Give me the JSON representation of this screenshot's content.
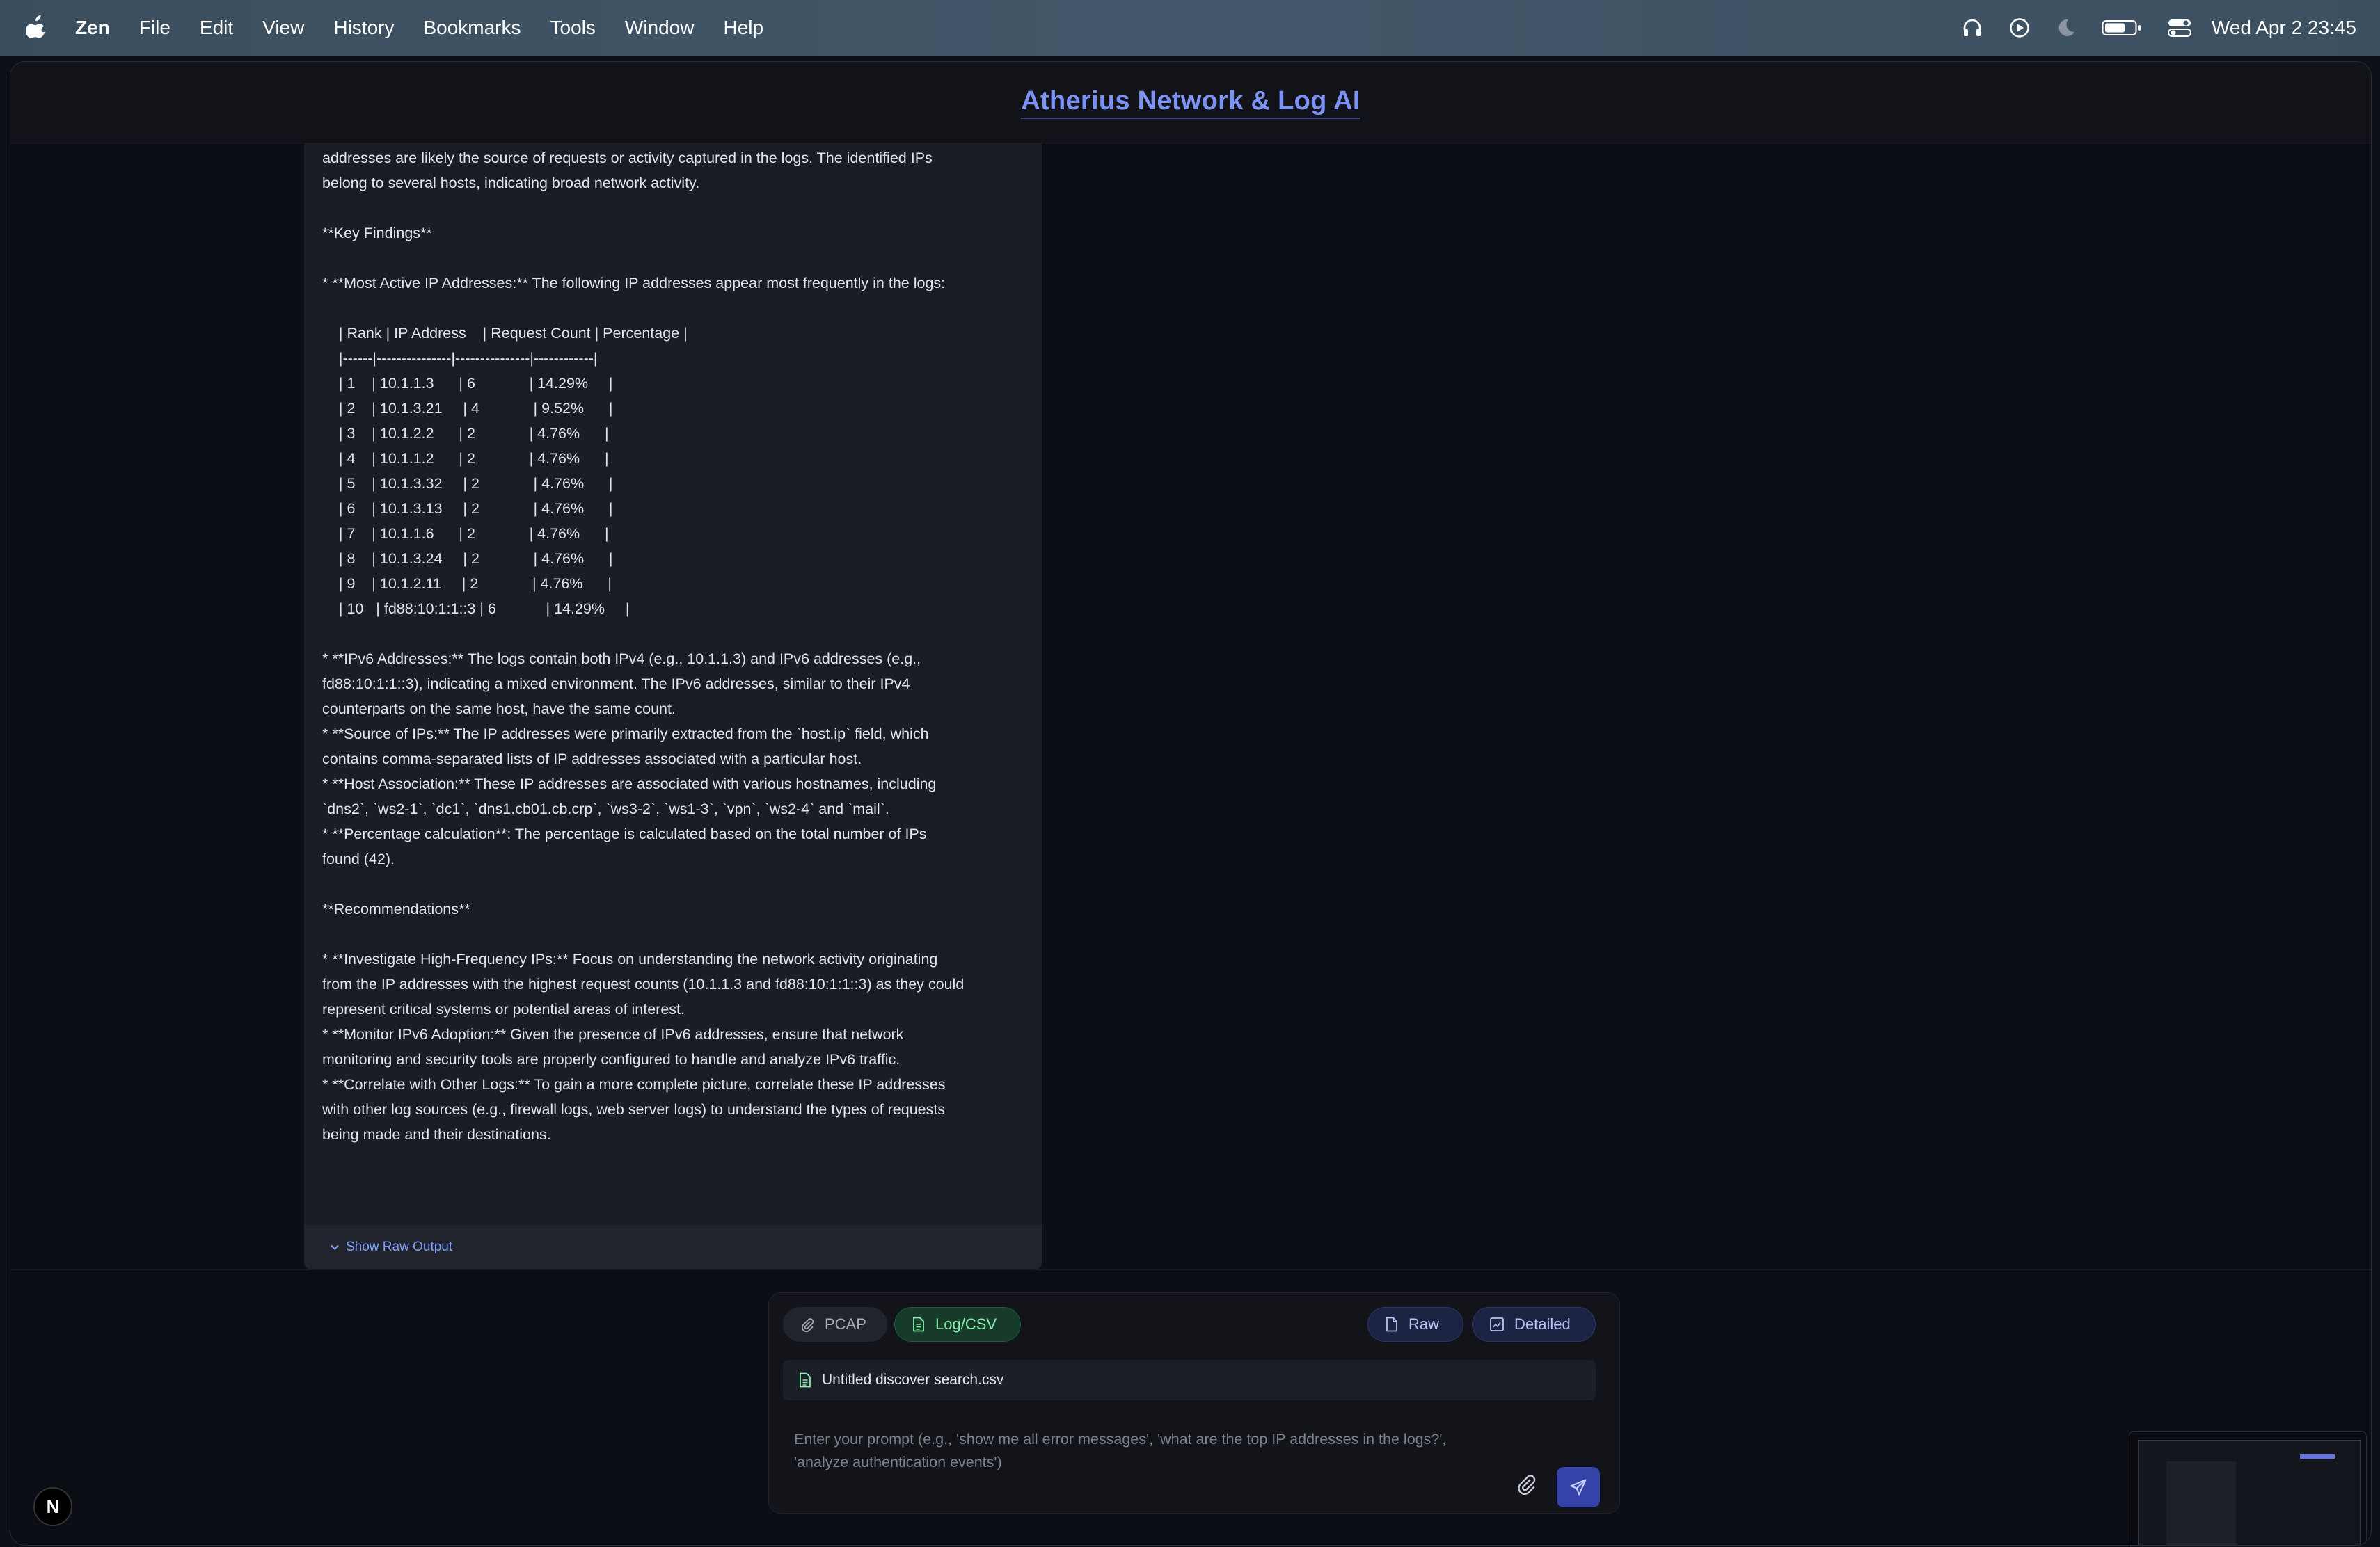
{
  "menubar": {
    "app_name": "Zen",
    "menus": [
      "File",
      "Edit",
      "View",
      "History",
      "Bookmarks",
      "Tools",
      "Window",
      "Help"
    ],
    "clock": "Wed Apr 2  23:45"
  },
  "app": {
    "title": "Atherius Network & Log AI"
  },
  "message": {
    "lines": [
      "addresses are likely the source of requests or activity captured in the logs. The identified IPs",
      "belong to several hosts, indicating broad network activity.",
      "",
      "**Key Findings**",
      "",
      "*   **Most Active IP Addresses:** The following IP addresses appear most frequently in the logs:",
      "",
      "    | Rank | IP Address    | Request Count | Percentage |",
      "    |------|---------------|---------------|------------|",
      "    | 1    | 10.1.1.3      | 6             | 14.29%     |",
      "    | 2    | 10.1.3.21     | 4             | 9.52%      |",
      "    | 3    | 10.1.2.2      | 2             | 4.76%      |",
      "    | 4    | 10.1.1.2      | 2             | 4.76%      |",
      "    | 5    | 10.1.3.32     | 2             | 4.76%      |",
      "    | 6    | 10.1.3.13     | 2             | 4.76%      |",
      "    | 7    | 10.1.1.6      | 2             | 4.76%      |",
      "    | 8    | 10.1.3.24     | 2             | 4.76%      |",
      "    | 9    | 10.1.2.11     | 2             | 4.76%      |",
      "    | 10   | fd88:10:1:1::3 | 6            | 14.29%     |",
      "",
      "*   **IPv6 Addresses:** The logs contain both IPv4 (e.g., 10.1.1.3) and IPv6 addresses (e.g.,",
      "fd88:10:1:1::3), indicating a mixed environment. The IPv6 addresses, similar to their IPv4",
      "counterparts on the same host, have the same count.",
      "*   **Source of IPs:** The IP addresses were primarily extracted from the `host.ip` field, which",
      "contains comma-separated lists of IP addresses associated with a particular host.",
      "*   **Host Association:** These IP addresses are associated with various hostnames, including",
      "`dns2`, `ws2-1`, `dc1`, `dns1.cb01.cb.crp`, `ws3-2`, `ws1-3`, `vpn`, `ws2-4` and `mail`.",
      "*   **Percentage calculation**: The percentage is calculated based on the total number of IPs",
      "found (42).",
      "",
      "**Recommendations**",
      "",
      "*   **Investigate High-Frequency IPs:** Focus on understanding the network activity originating",
      "from the IP addresses with the highest request counts (10.1.1.3 and fd88:10:1:1::3) as they could",
      "represent critical systems or potential areas of interest.",
      "*   **Monitor IPv6 Adoption:** Given the presence of IPv6 addresses, ensure that network",
      "monitoring and security tools are properly configured to handle and analyze IPv6 traffic.",
      "*   **Correlate with Other Logs:** To gain a more complete picture, correlate these IP addresses",
      "with other log sources (e.g., firewall logs, web server logs) to understand the types of requests",
      "being made and their destinations."
    ],
    "show_raw_label": "Show Raw Output"
  },
  "composer": {
    "pcap_label": "PCAP",
    "log_label": "Log/CSV",
    "raw_label": "Raw",
    "detailed_label": "Detailed",
    "file_name": "Untitled discover search.csv",
    "prompt_placeholder": "Enter your prompt (e.g., 'show me all error messages', 'what are the top IP addresses in the logs?', 'analyze authentication events')"
  },
  "badge": {
    "label": "N"
  },
  "colors": {
    "accent": "#7c93f5",
    "send": "#3542a8",
    "log_chip": "#86efac"
  }
}
